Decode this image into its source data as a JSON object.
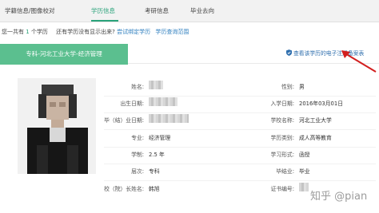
{
  "tabs": [
    {
      "label": "学籍信息/图像校对"
    },
    {
      "label": "学历信息"
    },
    {
      "label": "考研信息"
    },
    {
      "label": "毕业去向"
    }
  ],
  "info": {
    "prefix": "您一共有",
    "count": "1",
    "suffix": "个学历",
    "question": "还有学历没有显示出来?",
    "bind_link": "尝试绑定学历",
    "scope_link": "学历查询范围"
  },
  "card": {
    "degree_tab": "专科-河北工业大学-经济管理",
    "record_link": "查看该学历的电子注册备案表"
  },
  "fields_left": [
    {
      "label": "姓名:",
      "value": ""
    },
    {
      "label": "出生日期:",
      "value": ""
    },
    {
      "label": "毕（结）业日期:",
      "value": ""
    },
    {
      "label": "专业:",
      "value": "经济管理"
    },
    {
      "label": "学制:",
      "value": "2.5 年"
    },
    {
      "label": "层次:",
      "value": "专科"
    },
    {
      "label": "校（院）长姓名:",
      "value": "韩旭"
    }
  ],
  "fields_right": [
    {
      "label": "性别:",
      "value": "男"
    },
    {
      "label": "入学日期:",
      "value": "2016年03月01日"
    },
    {
      "label": "学校名称:",
      "value": "河北工业大学"
    },
    {
      "label": "学历类别:",
      "value": "成人高等教育"
    },
    {
      "label": "学习形式:",
      "value": "函授"
    },
    {
      "label": "毕结业:",
      "value": "毕业"
    },
    {
      "label": "证书编号:",
      "value": ""
    }
  ],
  "watermark": "知乎 @pian",
  "colors": {
    "accent": "#2aa37a",
    "tab_bg": "#5bbf8f",
    "link": "#2f6fae",
    "arrow": "#d21f1f"
  },
  "icons": [
    "shield-icon",
    "arrow-icon"
  ]
}
